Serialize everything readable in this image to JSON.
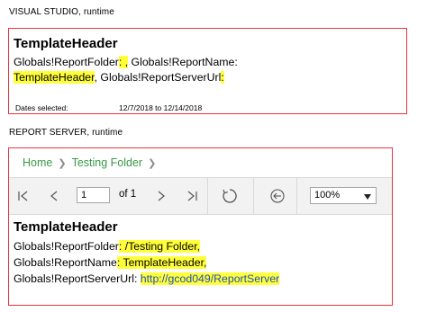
{
  "vs": {
    "label": "VISUAL STUDIO, runtime",
    "title": "TemplateHeader",
    "line1_a": "Globals!ReportFolder",
    "line1_hl": ": ,",
    "line1_b": " Globals!ReportName:",
    "line2_hl": "TemplateHeader",
    "line2_a": ", Globals!ReportServerUrl",
    "line2_hl2": ":",
    "dates_label": "Dates selected:",
    "dates_value": "12/7/2018 to 12/14/2018"
  },
  "rs": {
    "label": "REPORT SERVER, runtime",
    "breadcrumb": {
      "home": "Home",
      "folder": "Testing Folder"
    },
    "toolbar": {
      "page_value": "1",
      "of_label": "of 1",
      "zoom": "100%"
    },
    "title": "TemplateHeader",
    "line1_a": "Globals!ReportFolder",
    "line1_hl": ": /Testing Folder,",
    "line2_a": "Globals!ReportName",
    "line2_hl": ": TemplateHeader,",
    "line3_a": "Globals!ReportServerUrl: ",
    "line3_hl": "http://gcod049/ReportServer"
  },
  "colors": {
    "highlight": "#ffff3a",
    "border": "#e8343e",
    "breadcrumb": "#3a9a48",
    "link": "#1f4fbf"
  },
  "icons": [
    "first-page-icon",
    "previous-page-icon",
    "next-page-icon",
    "last-page-icon",
    "refresh-icon",
    "back-icon",
    "dropdown-caret-icon",
    "breadcrumb-chevron-icon"
  ]
}
